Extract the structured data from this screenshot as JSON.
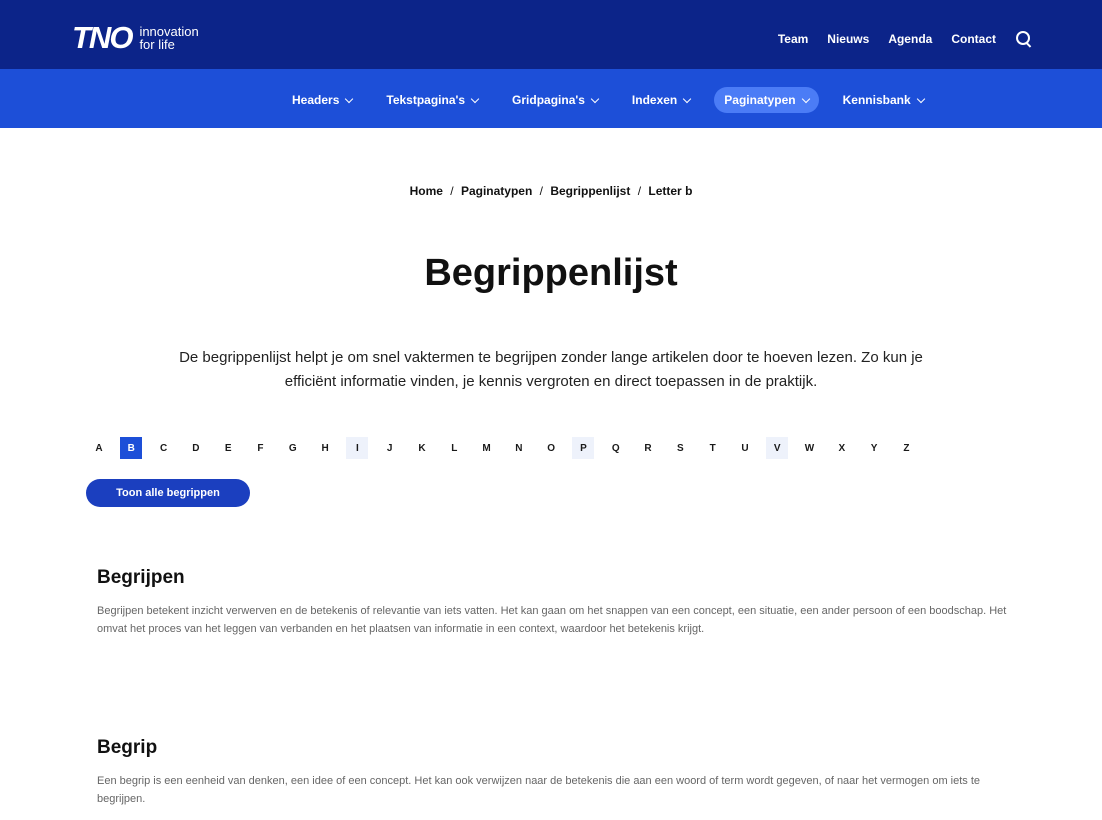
{
  "brand": {
    "logo": "TNO",
    "tagline_line1": "innovation",
    "tagline_line2": "for life"
  },
  "topnav": {
    "items": [
      "Team",
      "Nieuws",
      "Agenda",
      "Contact"
    ],
    "search_icon": "search-icon"
  },
  "subnav": {
    "items": [
      {
        "label": "Headers",
        "active": false
      },
      {
        "label": "Tekstpagina's",
        "active": false
      },
      {
        "label": "Gridpagina's",
        "active": false
      },
      {
        "label": "Indexen",
        "active": false
      },
      {
        "label": "Paginatypen",
        "active": true
      },
      {
        "label": "Kennisbank",
        "active": false
      }
    ]
  },
  "breadcrumb": {
    "items": [
      "Home",
      "Paginatypen",
      "Begrippenlijst",
      "Letter b"
    ],
    "separator": "/"
  },
  "page": {
    "title": "Begrippenlijst",
    "intro": "De begrippenlijst helpt je om snel vaktermen te begrijpen zonder lange artikelen door te hoeven lezen. Zo kun je efficiënt informatie vinden, je kennis vergroten en direct toepassen in de praktijk."
  },
  "alphabet": {
    "letters": [
      "A",
      "B",
      "C",
      "D",
      "E",
      "F",
      "G",
      "H",
      "I",
      "J",
      "K",
      "L",
      "M",
      "N",
      "O",
      "P",
      "Q",
      "R",
      "S",
      "T",
      "U",
      "V",
      "W",
      "X",
      "Y",
      "Z"
    ],
    "active": "B",
    "highlighted": [
      "I",
      "P",
      "V"
    ]
  },
  "show_all_label": "Toon alle begrippen",
  "terms": [
    {
      "title": "Begrijpen",
      "body": "Begrijpen betekent inzicht verwerven en de betekenis of relevantie van iets vatten. Het kan gaan om het snappen van een concept, een situatie, een ander persoon of een boodschap. Het omvat het proces van het leggen van verbanden en het plaatsen van informatie in een context, waardoor het betekenis krijgt."
    },
    {
      "title": "Begrip",
      "body": "Een begrip is een eenheid van denken, een idee of een concept. Het kan ook verwijzen naar de betekenis die aan een woord of term wordt gegeven, of naar het vermogen om iets te begrijpen."
    }
  ],
  "colors": {
    "topbar": "#0c2489",
    "subbar": "#1d4fd8",
    "active_pill": "#4b7cf6",
    "button": "#1b3fbf"
  }
}
